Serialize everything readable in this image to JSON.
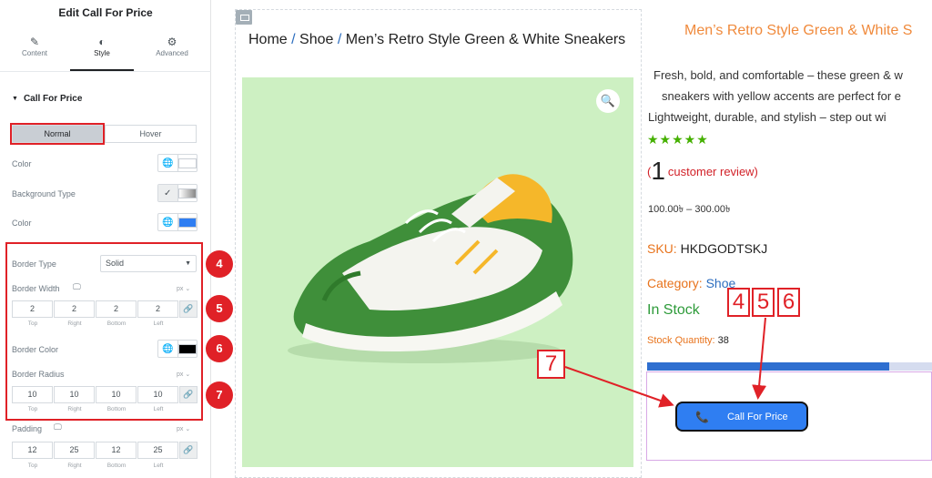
{
  "panel": {
    "title": "Edit Call For Price",
    "tabs": [
      {
        "label": "Content",
        "icon": "pencil-icon"
      },
      {
        "label": "Style",
        "icon": "half-circle-icon"
      },
      {
        "label": "Advanced",
        "icon": "gear-icon"
      }
    ],
    "section_title": "Call For Price",
    "state_toggle": {
      "normal": "Normal",
      "hover": "Hover"
    },
    "color_label": "Color",
    "background_type_label": "Background Type",
    "color2_label": "Color",
    "border_type": {
      "label": "Border Type",
      "value": "Solid"
    },
    "border_width": {
      "label": "Border Width",
      "unit": "px",
      "values": [
        "2",
        "2",
        "2",
        "2"
      ]
    },
    "border_color_label": "Border Color",
    "border_radius": {
      "label": "Border Radius",
      "unit": "px",
      "values": [
        "10",
        "10",
        "10",
        "10"
      ]
    },
    "padding": {
      "label": "Padding",
      "unit": "px",
      "values": [
        "12",
        "25",
        "12",
        "25"
      ]
    },
    "dim_labels": [
      "Top",
      "Right",
      "Bottom",
      "Left"
    ],
    "colors": {
      "text_color": "#ffffff",
      "bg_color": "#2f7ef2",
      "border_color": "#000000"
    }
  },
  "badges": [
    "4",
    "5",
    "6",
    "7"
  ],
  "preview": {
    "breadcrumb": {
      "home": "Home",
      "sep": "/",
      "category": "Shoe",
      "product": "Men’s Retro Style Green & White Sneakers"
    },
    "product_title": "Men’s Retro Style Green & White S",
    "description": [
      "Fresh, bold, and comfortable – these green & w",
      "sneakers with yellow accents are perfect for e",
      "Lightweight, durable, and stylish – step out wi"
    ],
    "stars": "★★★★★",
    "review": {
      "open": "(",
      "count": "1",
      "text": "customer review)"
    },
    "price": "100.00৳  – 300.00৳",
    "sku": {
      "label": "SKU:",
      "value": "HKDGODTSKJ"
    },
    "category": {
      "label": "Category:",
      "value": "Shoe"
    },
    "stock_status": "In Stock",
    "stock_qty": {
      "label": "Stock Quantity:",
      "value": "38"
    },
    "stock_fill": 0.85,
    "cta_label": "Call For Price",
    "callouts": {
      "a": "4",
      "b": "5",
      "c": "6",
      "d": "7"
    }
  }
}
